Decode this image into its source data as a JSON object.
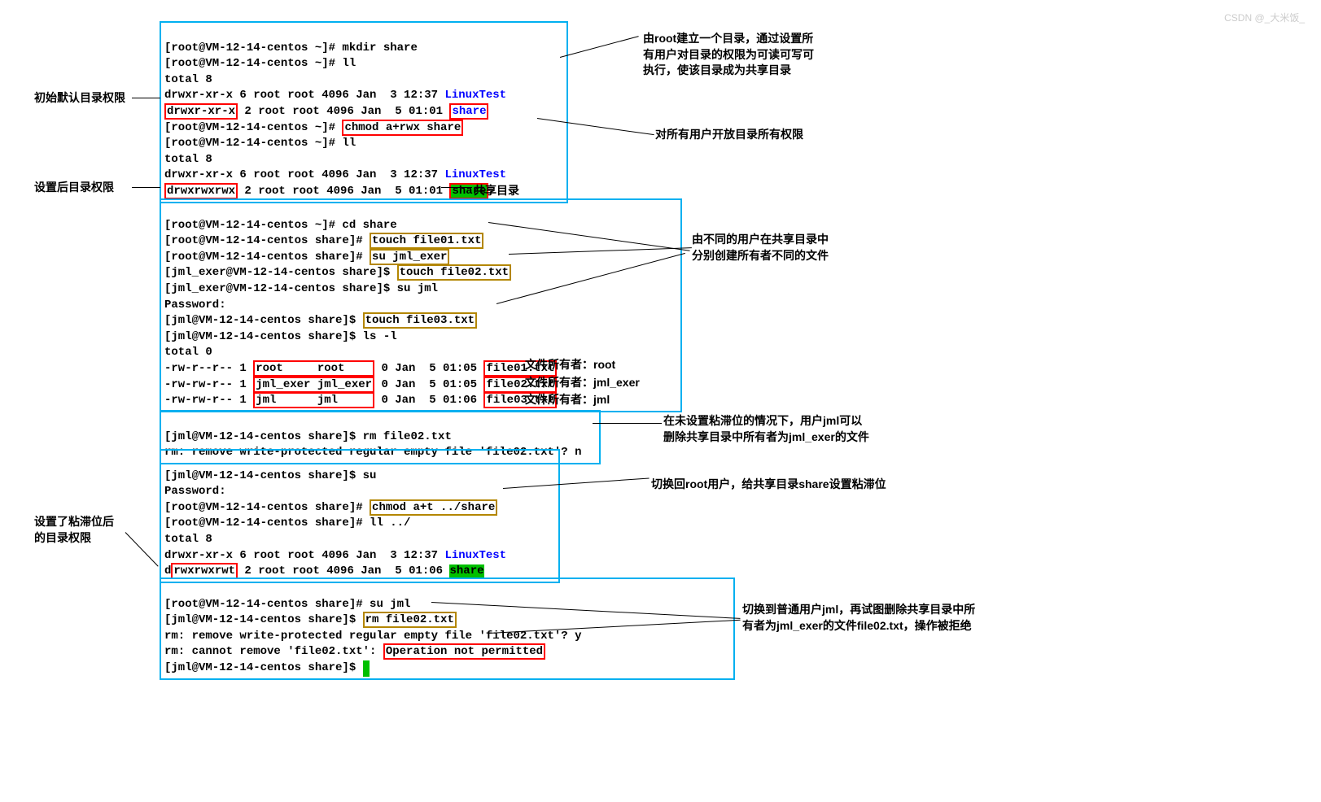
{
  "b1": {
    "l1a": "[root@VM-12-14-centos ~]# mkdir share",
    "l2": "[root@VM-12-14-centos ~]# ll",
    "l3": "total 8",
    "l4a": "drwxr-xr-x 6 root root 4096 Jan  3 12:37 ",
    "l4b": "LinuxTest",
    "l5a": "drwxr-xr-x",
    "l5b": " 2 root root 4096 Jan  5 01:01 ",
    "l5c": "share",
    "l6a": "[root@VM-12-14-centos ~]# ",
    "l6b": "chmod a+rwx share",
    "l7": "[root@VM-12-14-centos ~]# ll",
    "l8": "total 8",
    "l9a": "drwxr-xr-x 6 root root 4096 Jan  3 12:37 ",
    "l9b": "LinuxTest",
    "l10a": "drwxrwxrwx",
    "l10b": " 2 root root 4096 Jan  5 01:01 ",
    "l10c": "share"
  },
  "b2": {
    "l1": "[root@VM-12-14-centos ~]# cd share",
    "l2a": "[root@VM-12-14-centos share]# ",
    "l2b": "touch file01.txt",
    "l3a": "[root@VM-12-14-centos share]# ",
    "l3b": "su jml_exer",
    "l4a": "[jml_exer@VM-12-14-centos share]$ ",
    "l4b": "touch file02.txt",
    "l5": "[jml_exer@VM-12-14-centos share]$ su jml",
    "l6": "Password:",
    "l7a": "[jml@VM-12-14-centos share]$ ",
    "l7b": "touch file03.txt",
    "l8": "[jml@VM-12-14-centos share]$ ls -l",
    "l9": "total 0",
    "l10a": "-rw-r--r-- 1 ",
    "l10u": "root     root    ",
    "l10b": " 0 Jan  5 01:05 ",
    "l10c": "file01.txt",
    "l11a": "-rw-rw-r-- 1 ",
    "l11u": "jml_exer jml_exer",
    "l11b": " 0 Jan  5 01:05 ",
    "l11c": "file02.txt",
    "l12a": "-rw-rw-r-- 1 ",
    "l12u": "jml      jml     ",
    "l12b": " 0 Jan  5 01:06 ",
    "l12c": "file03.txt"
  },
  "b3": {
    "l1": "[jml@VM-12-14-centos share]$ rm file02.txt",
    "l2": "rm: remove write-protected regular empty file 'file02.txt'? n"
  },
  "b4": {
    "l1": "[jml@VM-12-14-centos share]$ su",
    "l2": "Password:",
    "l3a": "[root@VM-12-14-centos share]# ",
    "l3b": "chmod a+t ../share",
    "l4": "[root@VM-12-14-centos share]# ll ../",
    "l5": "total 8",
    "l6a": "drwxr-xr-x 6 root root 4096 Jan  3 12:37 ",
    "l6b": "LinuxTest",
    "l7a1": "d",
    "l7a2": "rwxrwxrwt",
    "l7b": " 2 root root 4096 Jan  5 01:06 ",
    "l7c": "share"
  },
  "b5": {
    "l1": "[root@VM-12-14-centos share]# su jml",
    "l2a": "[jml@VM-12-14-centos share]$ ",
    "l2b": "rm file02.txt",
    "l3": "rm: remove write-protected regular empty file 'file02.txt'? y",
    "l4a": "rm: cannot remove 'file02.txt': ",
    "l4b": "Operation not permitted",
    "l5": "[jml@VM-12-14-centos share]$ "
  },
  "ann": {
    "a1": "初始默认目录权限",
    "a2": "设置后目录权限",
    "a3": "由root建立一个目录，通过设置所\n有用户对目录的权限为可读可写可\n执行，使该目录成为共享目录",
    "a4": "对所有用户开放目录所有权限",
    "a5": "共享目录",
    "a6": "由不同的用户在共享目录中\n分别创建所有者不同的文件",
    "a7": "文件所有者：root",
    "a8": "文件所有者：jml_exer",
    "a9": "文件所有者：jml",
    "a10": "在未设置粘滞位的情况下，用户jml可以\n删除共享目录中所有者为jml_exer的文件",
    "a11": "切换回root用户，给共享目录share设置粘滞位",
    "a12": "设置了粘滞位后\n的目录权限",
    "a13": "切换到普通用户jml，再试图删除共享目录中所\n有者为jml_exer的文件file02.txt，操作被拒绝"
  },
  "wm": "CSDN @_大米饭_"
}
